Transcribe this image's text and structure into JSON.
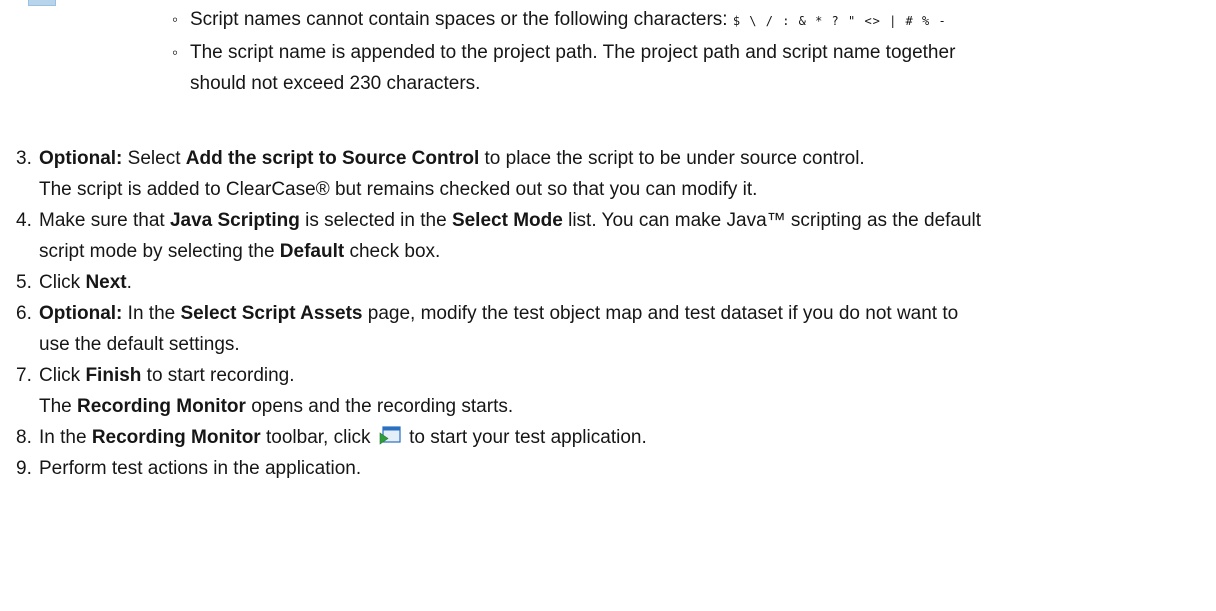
{
  "sub_bullets": [
    {
      "bullet": "◦",
      "text": "Script names cannot contain spaces or the following characters: ",
      "chars": "$ \\ / : & * ? \" <> | # % -"
    },
    {
      "bullet": "◦",
      "line1": "The script name is appended to the project path. The project path and script name together",
      "line2": "should not exceed 230 characters."
    }
  ],
  "steps": {
    "s3": {
      "num": "3.",
      "optional": "Optional:",
      "t1": " Select ",
      "b1": "Add the script to Source Control",
      "t2": " to place the script to be under source control.",
      "line2": "The script is added to ClearCase® but remains checked out so that you can modify it."
    },
    "s4": {
      "num": "4.",
      "t1": "Make sure that ",
      "b1": "Java Scripting",
      "t2": " is selected in the ",
      "b2": "Select Mode",
      "t3": " list. You can make Java™ scripting as the default",
      "t4": "script mode by selecting the ",
      "b3": "Default",
      "t5": " check box."
    },
    "s5": {
      "num": "5.",
      "t1": "Click ",
      "b1": "Next",
      "t2": "."
    },
    "s6": {
      "num": "6.",
      "optional": "Optional:",
      "t1": " In the ",
      "b1": "Select Script Assets",
      "t2": " page, modify the test object map and test dataset if you do not want to",
      "t3": "use the default settings."
    },
    "s7": {
      "num": "7.",
      "t1": "Click ",
      "b1": "Finish",
      "t2": " to start recording.",
      "t3": "The ",
      "b2": "Recording Monitor",
      "t4": " opens and the recording starts."
    },
    "s8": {
      "num": "8.",
      "t1": "In the ",
      "b1": "Recording Monitor",
      "t2": " toolbar, click ",
      "icon": "start-application-icon",
      "t3": " to start your test application."
    },
    "s9": {
      "num": "9.",
      "t1": "Perform test actions in the application."
    }
  },
  "colors": {
    "text": "#161616",
    "icon_blue": "#2a6fc0",
    "icon_green": "#2f9e3a"
  }
}
